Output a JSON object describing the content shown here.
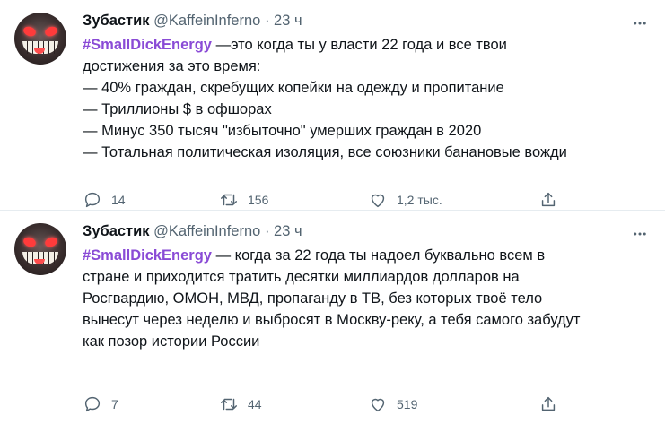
{
  "tweets": [
    {
      "author": "Зубастик",
      "handle": "@KaffeinInferno",
      "dot": "·",
      "time": "23 ч",
      "hashtag": "#SmallDickEnergy",
      "lines": [
        " —это когда ты у власти 22 года и все твои",
        "достижения за это время:",
        "— 40% граждан, скребущих копейки на одежду и пропитание",
        "— Триллионы $ в офшорах",
        "— Минус 350 тысяч \"избыточно\" умерших граждан в 2020",
        "— Тотальная политическая изоляция, все союзники банановые вожди"
      ],
      "replies": "14",
      "retweets": "156",
      "likes": "1,2 тыс."
    },
    {
      "author": "Зубастик",
      "handle": "@KaffeinInferno",
      "dot": "·",
      "time": "23 ч",
      "hashtag": "#SmallDickEnergy",
      "lines": [
        " — когда за 22 года ты надоел буквально всем в",
        "стране и приходится тратить десятки миллиардов долларов на",
        "Росгвардию, ОМОН, МВД, пропаганду в ТВ, без которых твоё тело",
        "вынесут через неделю и выбросят в Москву-реку, а тебя самого забудут",
        "как позор истории России"
      ],
      "replies": "7",
      "retweets": "44",
      "likes": "519"
    }
  ],
  "icons": [
    "more-icon",
    "reply-icon",
    "retweet-icon",
    "like-icon",
    "share-icon"
  ]
}
